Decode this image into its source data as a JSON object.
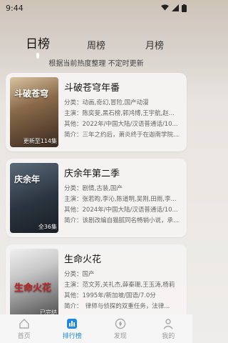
{
  "status": {
    "time": "9:44"
  },
  "tabs": [
    "日榜",
    "周榜",
    "月榜"
  ],
  "subtitle": "根据当前热度整理 不定时更新",
  "items": [
    {
      "title": "斗破苍穹年番",
      "category": "分类：动画,奇幻,冒险,国产动漫",
      "cast": "主演：陈奕斐,黑石榜,郭鸿博,王宇航,赵...",
      "other": "其他：2022年/中国大陆/汉语普通话/10...",
      "intro": "简介：三年之约后，萧炎终于在迦南学院...",
      "poster_text": "斗破苍穹",
      "badge": "更新至114集"
    },
    {
      "title": "庆余年第二季",
      "category": "分类：剧情,古装,国产",
      "cast": "主演：张若昀,李沁,陈道明,吴刚,田雨,李...",
      "other": "其他：2024年/中国大陆/汉语普通话/10...",
      "intro": "简介：该剧改编自猫腻同名畅销小说，承...",
      "poster_text": "庆余年",
      "badge": "全36集"
    },
    {
      "title": "生命火花",
      "category": "分类：国产",
      "cast": "主演：范文芳,关礼杰,薛秦珊,王玉涛,杨莉",
      "other": "其他：1995年/新加坡/国语/7.0分",
      "intro": "简介：　律师与侦探的双重任务，法律...",
      "poster_text": "生命火花",
      "badge": "已完结"
    }
  ],
  "nav": [
    "首页",
    "排行榜",
    "发现",
    "我的"
  ],
  "colors": {
    "accent": "#1e88e5"
  }
}
